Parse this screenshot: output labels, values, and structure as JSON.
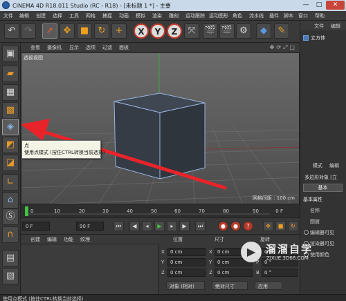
{
  "window": {
    "title": "CINEMA 4D R18.011 Studio (RC - R18) - [未标题 1 *] - 主要",
    "minimize": "—",
    "maximize": "□",
    "close": "✕"
  },
  "menubar": [
    "文件",
    "编辑",
    "创建",
    "选择",
    "工具",
    "网格",
    "捕捉",
    "动画",
    "模拟",
    "渲染",
    "雕刻",
    "运动跟踪",
    "运动图形",
    "角色",
    "流水线",
    "插件",
    "脚本",
    "窗口",
    "帮助"
  ],
  "toolbar": {
    "icons": [
      "undo-icon",
      "redo-icon",
      "select-icon",
      "move-icon",
      "scale-icon",
      "rotate-icon",
      "add-icon",
      "x-axis-icon",
      "y-axis-icon",
      "z-axis-icon",
      "world-coord-icon",
      "render-view-icon",
      "render-picture-icon",
      "render-settings-icon",
      "cube-icon",
      "pen-icon",
      "subdivision-icon",
      "array-icon",
      "deformer-icon",
      "floor-icon",
      "camera-icon",
      "light-icon"
    ],
    "axis_labels": [
      "X",
      "Y",
      "Z"
    ]
  },
  "viewport": {
    "menu": [
      "查看",
      "摄像机",
      "显示",
      "选项",
      "过滤",
      "面板"
    ],
    "label": "透视视图",
    "grid_distance": "网格间距 : 100 cm"
  },
  "leftbar": {
    "icons": [
      "make-editable-icon",
      "model-mode-icon",
      "texture-mode-icon",
      "points-mode-icon",
      "edges-mode-icon",
      "polygons-mode-icon",
      "axis-mode-icon",
      "tweak-mode-icon",
      "snap-icon",
      "workplane-icon",
      "lock-icon",
      "soft-selection-icon"
    ]
  },
  "tooltip": {
    "title": "点",
    "description": "使用点模式 (按住CTRL转换当前选择)"
  },
  "timeline": {
    "ticks": [
      "0",
      "10",
      "20",
      "30",
      "40",
      "50",
      "60",
      "70",
      "80",
      "90"
    ],
    "frame_display": "0 F"
  },
  "transport": {
    "start_field": "0 F",
    "end_field": "90 F",
    "current_field": "90 F"
  },
  "materials": {
    "menu": [
      "创建",
      "编辑",
      "功能",
      "纹理"
    ]
  },
  "coordinates": {
    "headers": [
      "位置",
      "尺寸",
      "旋转"
    ],
    "rows": [
      {
        "axis": "X",
        "pos": "0 cm",
        "size": "0 cm",
        "rot_label": "H",
        "rot": "0 °"
      },
      {
        "axis": "Y",
        "pos": "0 cm",
        "size": "0 cm",
        "rot_label": "P",
        "rot": "0 °"
      },
      {
        "axis": "Z",
        "pos": "0 cm",
        "size": "0 cm",
        "rot_label": "B",
        "rot": "0 °"
      }
    ],
    "mode_dropdown": "对象 (相对)",
    "size_dropdown": "绝对尺寸",
    "apply_button": "应用"
  },
  "object_manager": {
    "menu": [
      "文件",
      "编辑"
    ],
    "items": [
      "立方体"
    ]
  },
  "attributes": {
    "menu": [
      "模式",
      "编辑"
    ],
    "object_label": "多边形对象 [立",
    "tab": "基本",
    "section": "基本属性",
    "rows": [
      "名称",
      "图层",
      "编辑器可见",
      "渲染器可见",
      "使用颜色"
    ]
  },
  "status_bar": "使用点模式 (按住CTRL转换当前选择)",
  "watermark": {
    "name": "溜溜自学",
    "url": "ZIXUE.3D66.COM"
  },
  "colors": {
    "accent": "#f0a020",
    "arrow_red": "#e8242a",
    "axis_red": "#c23a2a",
    "playhead_green": "#3ec33e"
  }
}
